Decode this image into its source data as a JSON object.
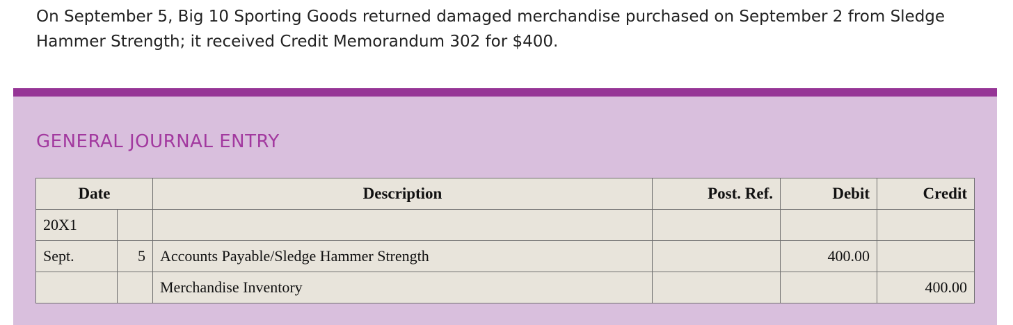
{
  "problem": {
    "text": "On September 5, Big 10 Sporting Goods returned damaged merchandise purchased on September 2 from Sledge Hammer Strength; it received Credit Memorandum 302 for $400."
  },
  "section": {
    "title": "GENERAL JOURNAL ENTRY"
  },
  "journal": {
    "headers": {
      "date": "Date",
      "description": "Description",
      "post_ref": "Post. Ref.",
      "debit": "Debit",
      "credit": "Credit"
    },
    "rows": [
      {
        "month": "20X1",
        "day": "",
        "description": "",
        "post_ref": "",
        "debit": "",
        "credit": ""
      },
      {
        "month": "Sept.",
        "day": "5",
        "description": "Accounts Payable/Sledge Hammer Strength",
        "post_ref": "",
        "debit": "400.00",
        "credit": ""
      },
      {
        "month": "",
        "day": "",
        "description": "Merchandise Inventory",
        "post_ref": "",
        "debit": "",
        "credit": "400.00"
      }
    ]
  },
  "colors": {
    "accent_bar": "#963596",
    "panel_background": "#d9bfdd",
    "title_color": "#a2399f",
    "table_background": "#e8e4db"
  }
}
